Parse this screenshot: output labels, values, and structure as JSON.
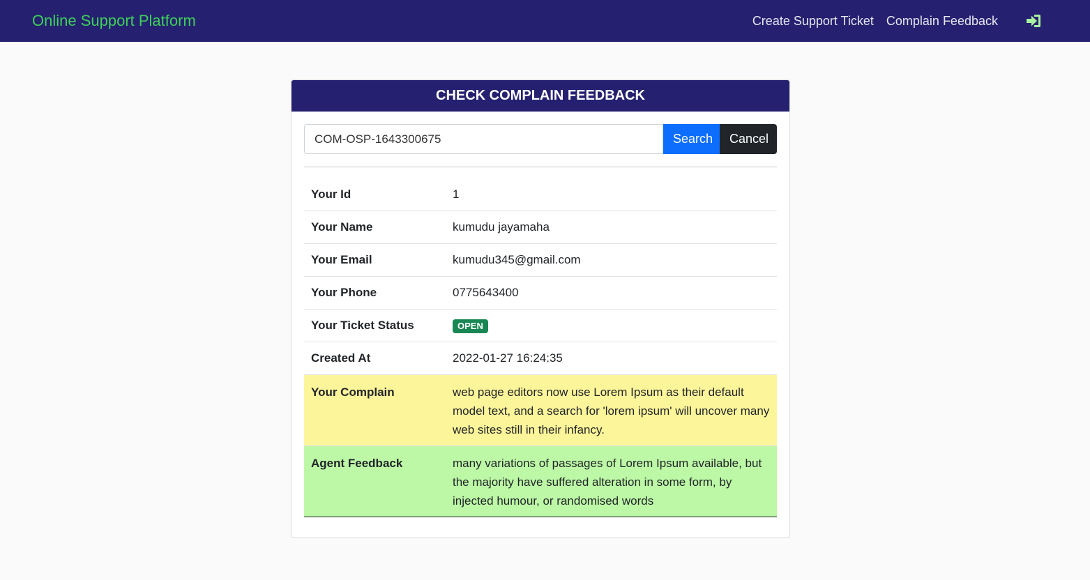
{
  "navbar": {
    "brand": "Online Support Platform",
    "links": [
      "Create Support Ticket",
      "Complain Feedback"
    ],
    "login_icon": "sign-in-icon",
    "brand_color": "#3ecf5a",
    "bg_color": "#252170"
  },
  "card": {
    "title": "CHECK COMPLAIN FEEDBACK",
    "search": {
      "value": "COM-OSP-1643300675",
      "search_label": "Search",
      "cancel_label": "Cancel"
    },
    "details": {
      "id_label": "Your Id",
      "id_value": "1",
      "name_label": "Your Name",
      "name_value": "kumudu jayamaha",
      "email_label": "Your Email",
      "email_value": "kumudu345@gmail.com",
      "phone_label": "Your Phone",
      "phone_value": "0775643400",
      "status_label": "Your Ticket Status",
      "status_value": "OPEN",
      "created_label": "Created At",
      "created_value": "2022-01-27 16:24:35",
      "complain_label": "Your Complain",
      "complain_value": "web page editors now use Lorem Ipsum as their default model text, and a search for 'lorem ipsum' will uncover many web sites still in their infancy.",
      "feedback_label": "Agent Feedback",
      "feedback_value": "many variations of passages of Lorem Ipsum available, but the majority have suffered alteration in some form, by injected humour, or randomised words"
    }
  },
  "colors": {
    "complain_bg": "#fdf59a",
    "feedback_bg": "#bdf8a6",
    "status_badge": "#198754",
    "search_button": "#0d6efd",
    "cancel_button": "#212529"
  }
}
